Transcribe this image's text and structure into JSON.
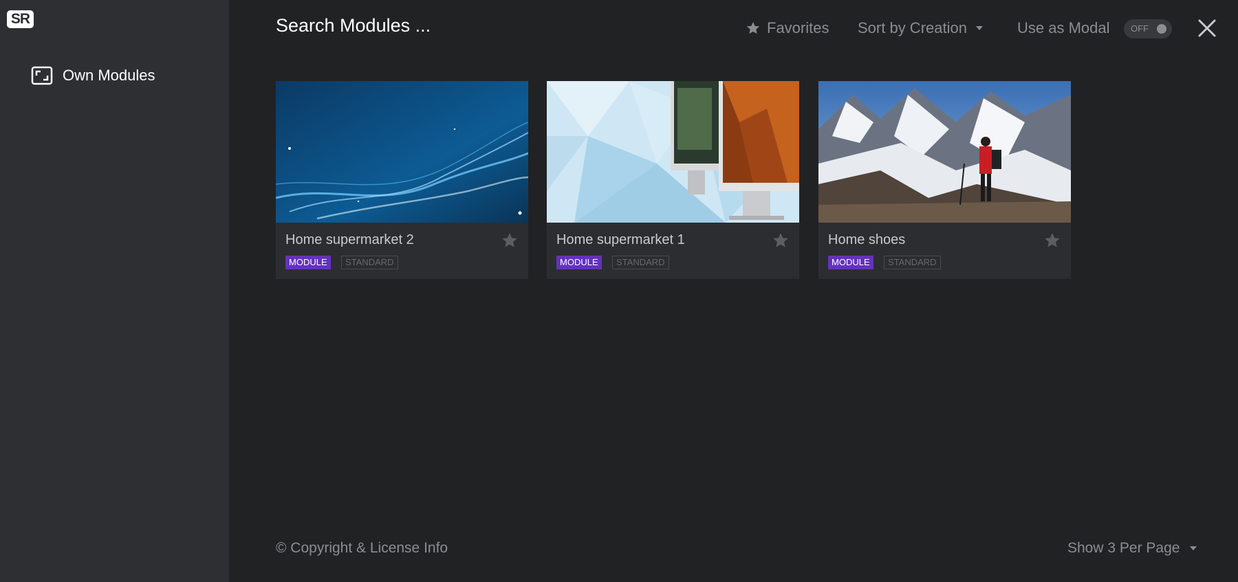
{
  "sidebar": {
    "logo_text": "SR",
    "items": [
      {
        "label": "Own Modules",
        "icon": "module-frame-icon"
      }
    ]
  },
  "header": {
    "title": "Search Modules ...",
    "favorites_label": "Favorites",
    "sort_label": "Sort by Creation",
    "modal_label": "Use as Modal",
    "modal_toggle_state": "OFF"
  },
  "cards": [
    {
      "title": "Home supermarket 2",
      "type_tag": "MODULE",
      "category_tag": "STANDARD"
    },
    {
      "title": "Home supermarket 1",
      "type_tag": "MODULE",
      "category_tag": "STANDARD"
    },
    {
      "title": "Home shoes",
      "type_tag": "MODULE",
      "category_tag": "STANDARD"
    }
  ],
  "footer": {
    "copyright": "© Copyright & License Info",
    "per_page": "Show 3 Per Page"
  },
  "colors": {
    "background": "#212224",
    "sidebar": "#2e2f33",
    "card": "#2c2d31",
    "module_tag": "#6432bd",
    "muted_text": "#8b8d92"
  }
}
